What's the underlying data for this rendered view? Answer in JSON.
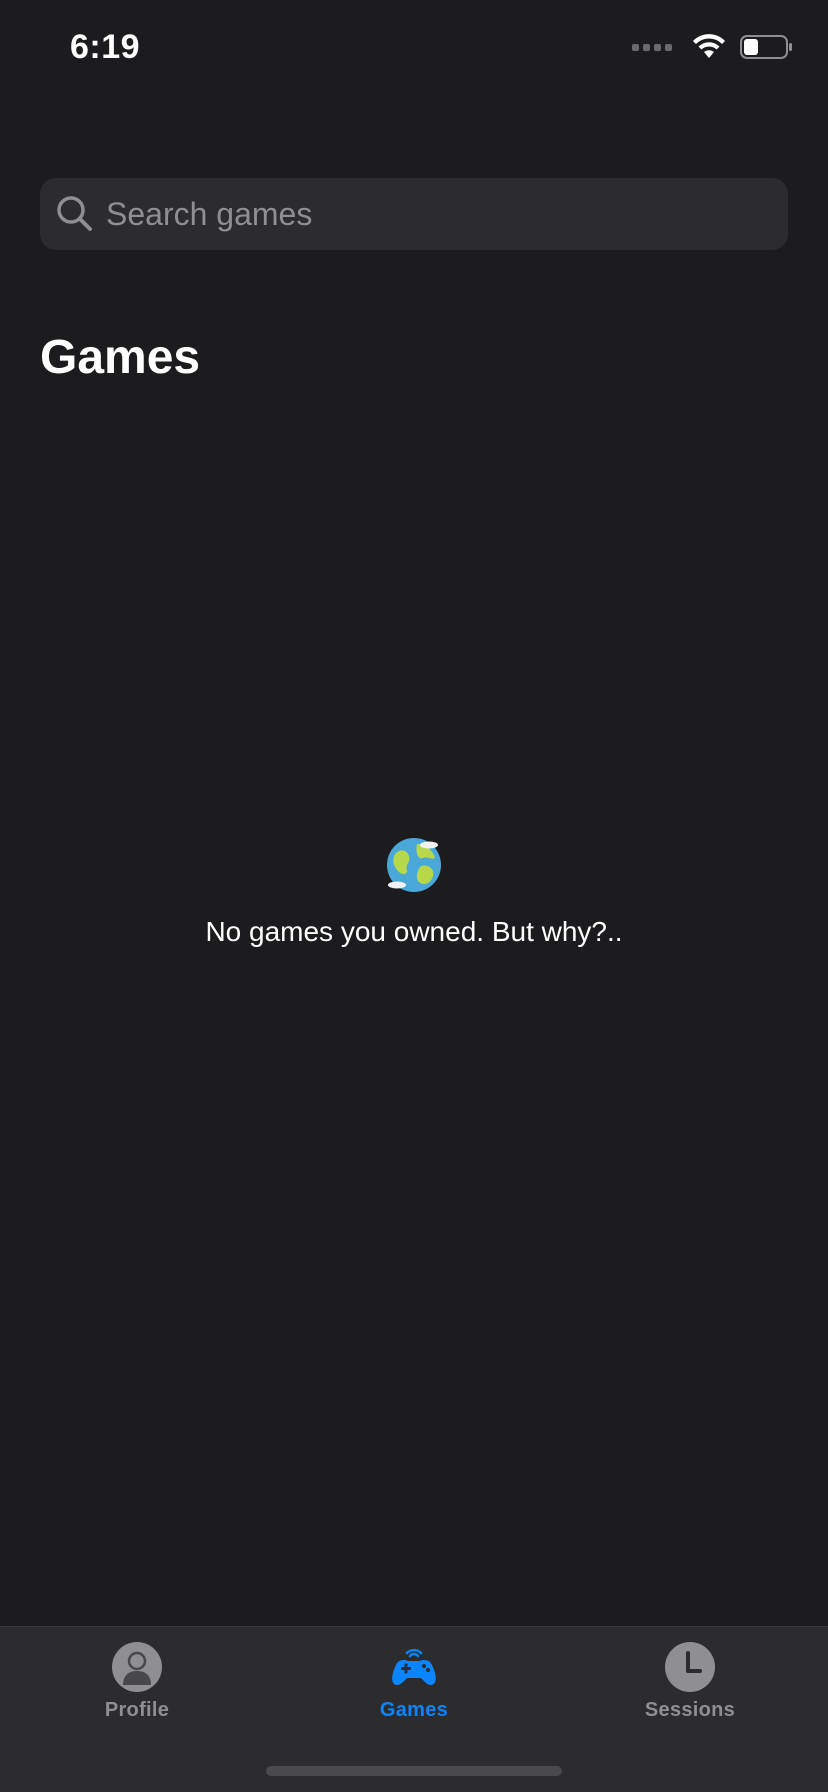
{
  "status_bar": {
    "time": "6:19",
    "icons": [
      "cellular-signal-icon",
      "wifi-icon",
      "battery-icon"
    ]
  },
  "search": {
    "placeholder": "Search games",
    "value": ""
  },
  "page_title": "Games",
  "empty_state": {
    "icon": "globe-icon",
    "message": "No games you owned. But why?.."
  },
  "tab_bar": {
    "tabs": [
      {
        "label": "Profile",
        "icon": "profile-icon",
        "selected": false
      },
      {
        "label": "Games",
        "icon": "gamepad-icon",
        "selected": true
      },
      {
        "label": "Sessions",
        "icon": "clock-icon",
        "selected": false
      }
    ]
  },
  "colors": {
    "background": "#1c1c1e",
    "surface": "#2c2c2e",
    "accent": "#0a84ff",
    "secondary_text": "#8e8e93"
  }
}
